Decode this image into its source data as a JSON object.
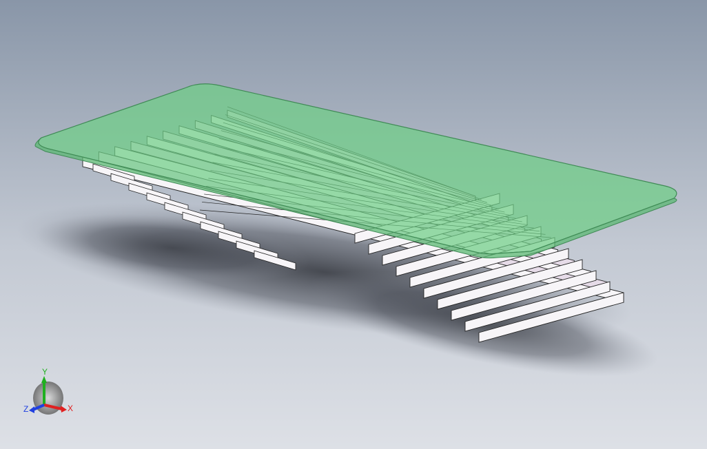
{
  "viewport": {
    "background_top": "#8996a8",
    "background_bottom": "#dde0e6",
    "glass_color": "#6fcf87",
    "glass_edge_color": "#3f8a55",
    "step_face_color": "#f7f5f8",
    "step_side_color": "#e6dbe8",
    "step_edge_color": "#222222"
  },
  "model": {
    "name": "twisted-stair-coffee-table",
    "step_count": 10
  },
  "triad": {
    "y_label": "Y",
    "x_label": "X",
    "z_label": "Z",
    "x_color": "#e02020",
    "y_color": "#20b020",
    "z_color": "#2040e0"
  }
}
